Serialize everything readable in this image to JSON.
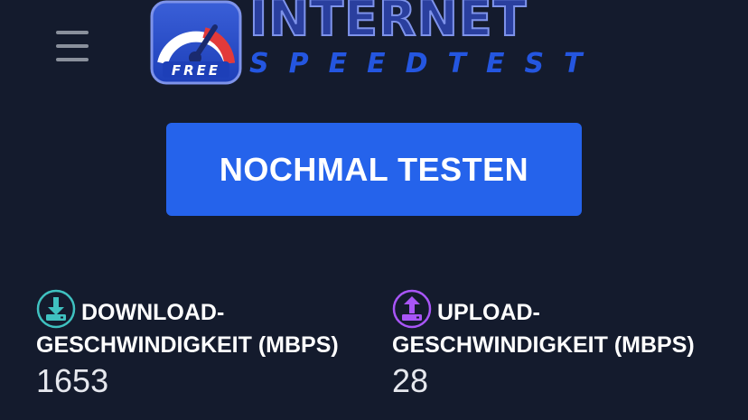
{
  "header": {
    "menu_icon": "hamburger-menu-icon",
    "logo": {
      "badge_text": "FREE",
      "word_1": "INTERNET",
      "word_2": "SPEEDTEST"
    }
  },
  "main": {
    "retest_label": "NOCHMAL TESTEN"
  },
  "results": {
    "download": {
      "icon": "download-icon",
      "label_line1": "DOWNLOAD-",
      "label_line2": "GESCHWINDIGKEIT (MBPS)",
      "value": "1653"
    },
    "upload": {
      "icon": "upload-icon",
      "label_line1": "UPLOAD-",
      "label_line2": "GESCHWINDIGKEIT (MBPS)",
      "value": "28"
    }
  },
  "colors": {
    "background": "#141b2d",
    "button": "#2563eb",
    "download_accent": "#3fc1c0",
    "upload_accent": "#a855f7"
  }
}
